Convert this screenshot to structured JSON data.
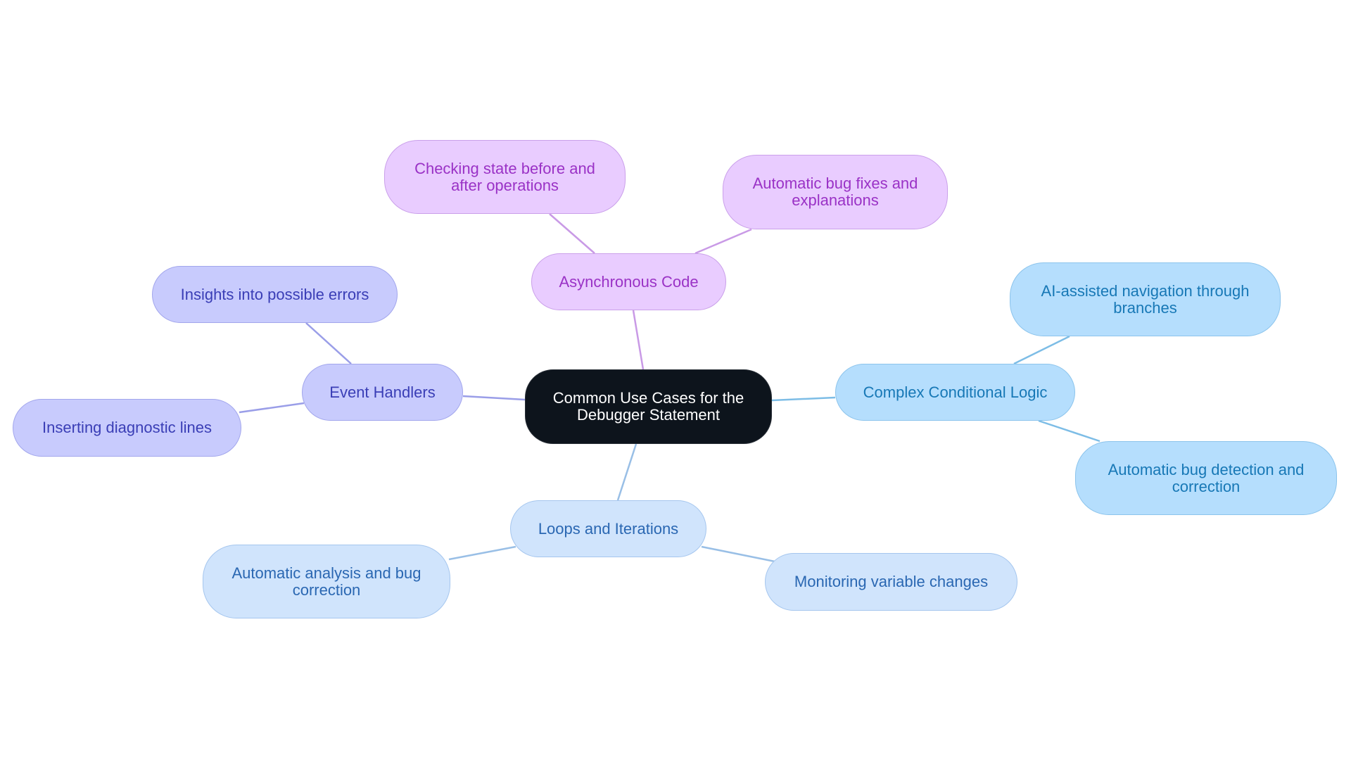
{
  "diagram": {
    "type": "mind-map",
    "root": {
      "label": "Common Use Cases for the Debugger Statement"
    },
    "branches": [
      {
        "id": "async",
        "label": "Asynchronous Code",
        "theme": "purple",
        "children": [
          {
            "label": "Checking state before and after operations"
          },
          {
            "label": "Automatic bug fixes and explanations"
          }
        ]
      },
      {
        "id": "complex",
        "label": "Complex Conditional Logic",
        "theme": "sky",
        "children": [
          {
            "label": "AI-assisted navigation through branches"
          },
          {
            "label": "Automatic bug detection and correction"
          }
        ]
      },
      {
        "id": "loops",
        "label": "Loops and Iterations",
        "theme": "pale",
        "children": [
          {
            "label": "Automatic analysis and bug correction"
          },
          {
            "label": "Monitoring variable changes"
          }
        ]
      },
      {
        "id": "events",
        "label": "Event Handlers",
        "theme": "indigo",
        "children": [
          {
            "label": "Insights into possible errors"
          },
          {
            "label": "Inserting diagnostic lines"
          }
        ]
      }
    ]
  },
  "colors": {
    "root_fill": "#0d141c",
    "purple_edge": "#c99ae6",
    "sky_edge": "#7dbde6",
    "pale_edge": "#99bfe6",
    "indigo_edge": "#9a9ee8"
  }
}
